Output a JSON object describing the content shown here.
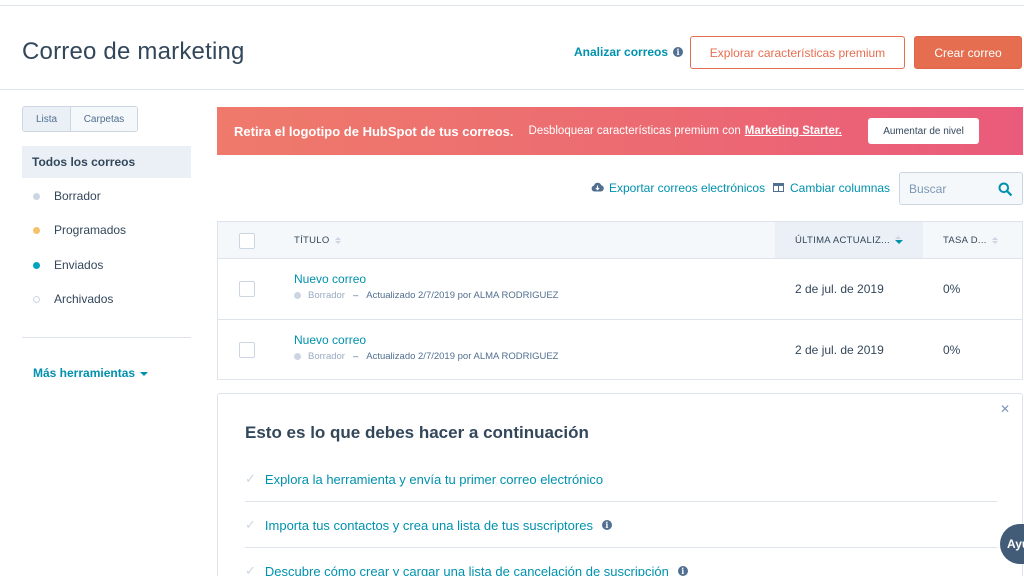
{
  "header": {
    "title": "Correo de marketing",
    "analyze_label": "Analizar correos",
    "premium_button": "Explorar características premium",
    "create_button": "Crear correo"
  },
  "sidebar": {
    "toggle": [
      "Lista",
      "Carpetas"
    ],
    "all_label": "Todos los correos",
    "items": [
      {
        "label": "Borrador",
        "color": "#cbd6e2"
      },
      {
        "label": "Programados",
        "color": "#f5c26b"
      },
      {
        "label": "Enviados",
        "color": "#00a4bd"
      },
      {
        "label": "Archivados",
        "color": "#ffffff"
      }
    ],
    "more_tools": "Más herramientas"
  },
  "banner": {
    "strong": "Retira el logotipo de HubSpot de tus correos.",
    "text": "Desbloquear características premium con",
    "link": "Marketing Starter.",
    "button": "Aumentar de nivel"
  },
  "tools": {
    "export": "Exportar correos electrónicos",
    "columns": "Cambiar columnas",
    "search_placeholder": "Buscar"
  },
  "table": {
    "columns": [
      "TÍTULO",
      "ÚLTIMA ACTUALIZ...",
      "TASA D..."
    ],
    "rows": [
      {
        "title": "Nuevo correo",
        "status": "Borrador",
        "dash": "–",
        "updated": "Actualizado 2/7/2019 por ALMA RODRIGUEZ",
        "date": "2 de jul. de 2019",
        "rate": "0%"
      },
      {
        "title": "Nuevo correo",
        "status": "Borrador",
        "dash": "–",
        "updated": "Actualizado 2/7/2019 por ALMA RODRIGUEZ",
        "date": "2 de jul. de 2019",
        "rate": "0%"
      }
    ]
  },
  "next_steps": {
    "title": "Esto es lo que debes hacer a continuación",
    "steps": [
      "Explora la herramienta y envía tu primer correo electrónico",
      "Importa tus contactos y crea una lista de tus suscriptores",
      "Descubre cómo crear y cargar una lista de cancelación de suscripción"
    ]
  },
  "help": {
    "label": "Ayu"
  },
  "colors": {
    "accent": "#e66e50",
    "link": "#0091ae",
    "text": "#33475b"
  }
}
